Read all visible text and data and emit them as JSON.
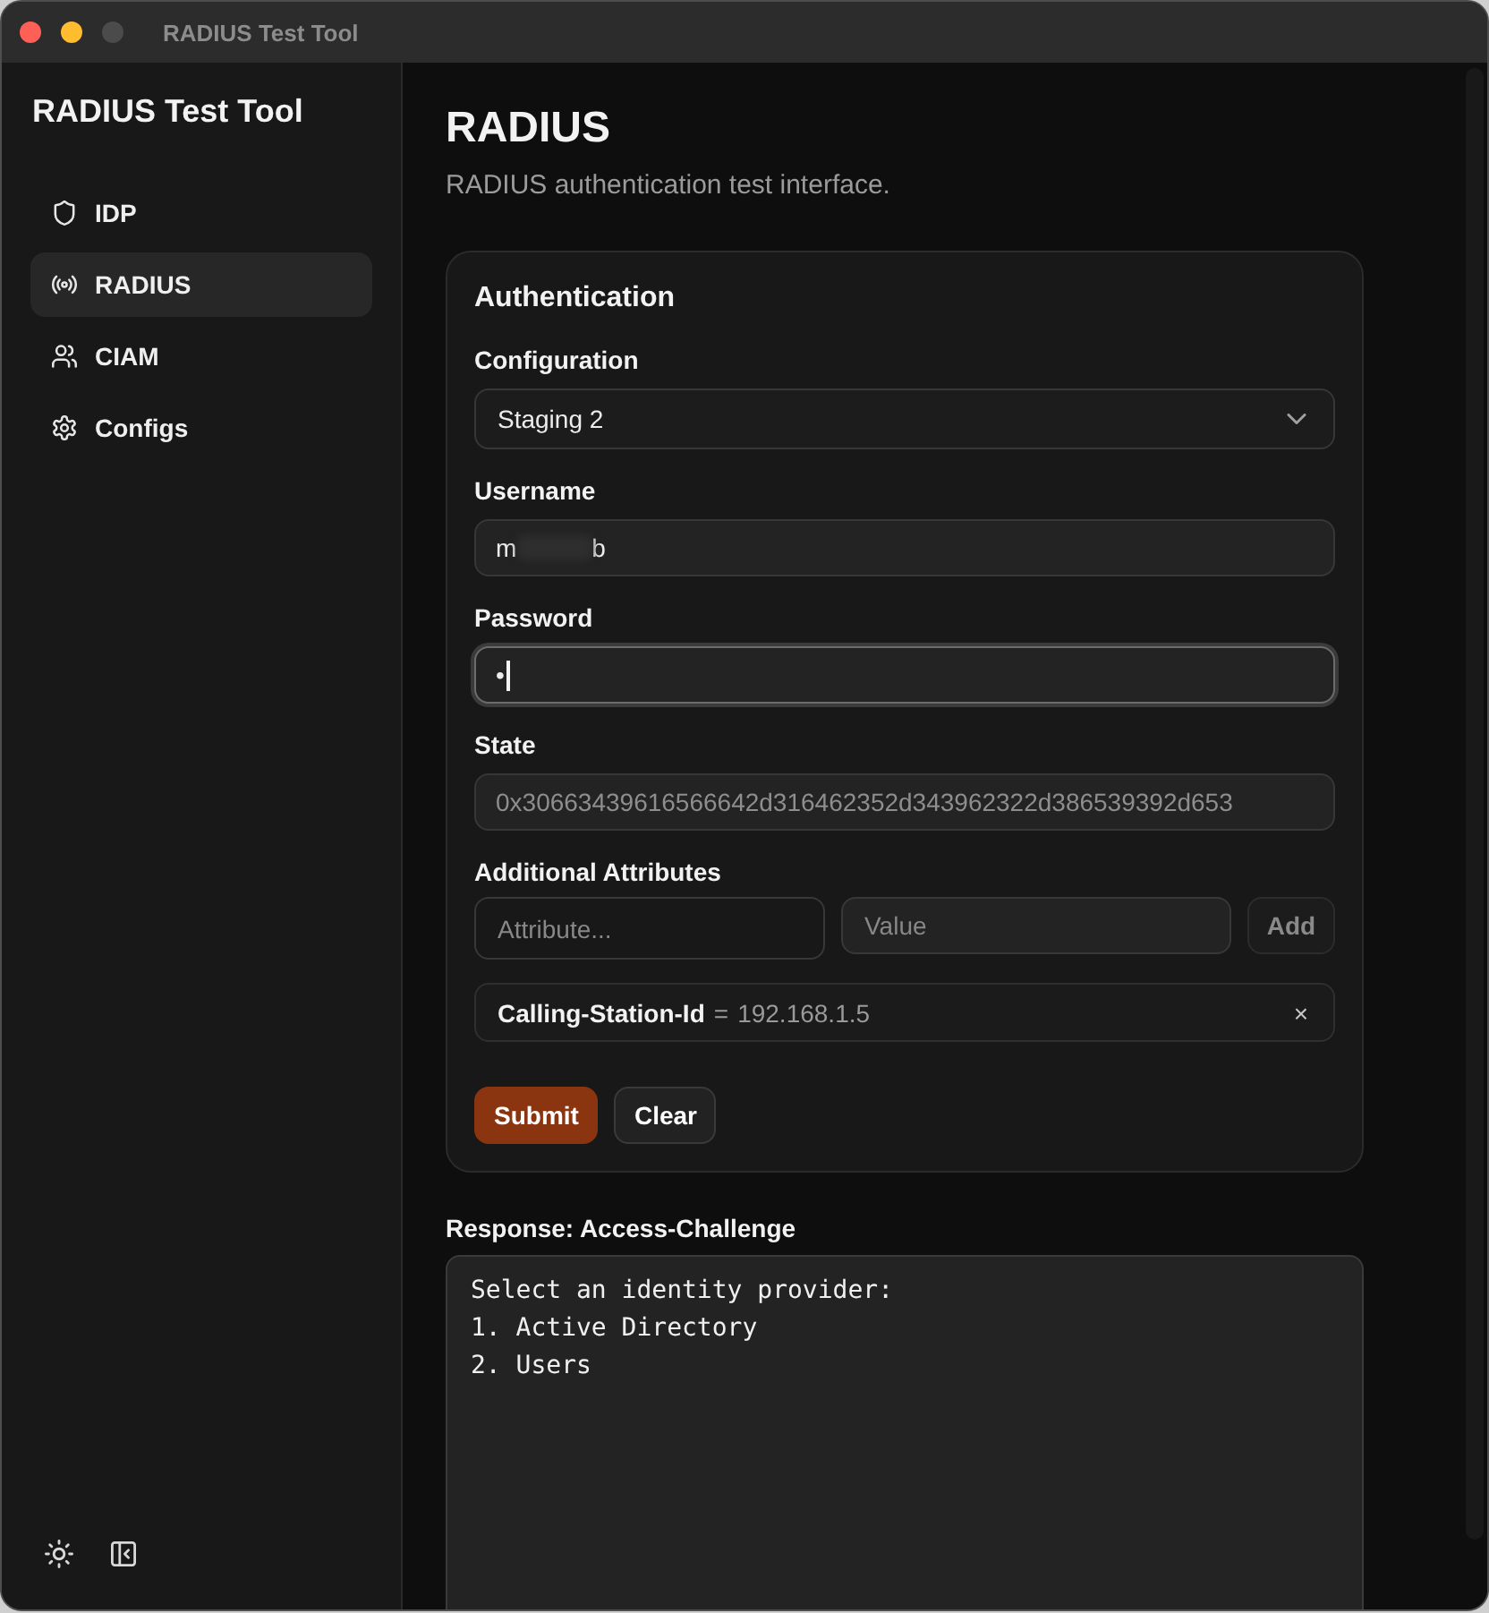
{
  "window": {
    "title": "RADIUS Test Tool"
  },
  "sidebar": {
    "title": "RADIUS Test Tool",
    "items": [
      {
        "label": "IDP",
        "selected": false
      },
      {
        "label": "RADIUS",
        "selected": true
      },
      {
        "label": "CIAM",
        "selected": false
      },
      {
        "label": "Configs",
        "selected": false
      }
    ]
  },
  "page": {
    "title": "RADIUS",
    "subtitle": "RADIUS authentication test interface."
  },
  "card": {
    "title": "Authentication",
    "fields": [
      {
        "kind": "select",
        "label": "Configuration",
        "value": "Staging 2",
        "focused": false,
        "disabled": false
      },
      {
        "kind": "text",
        "label": "Username",
        "value_parts": [
          "m",
          "b"
        ],
        "redacted": true,
        "focused": false,
        "disabled": false
      },
      {
        "kind": "password",
        "label": "Password",
        "value": "•",
        "focused": true,
        "disabled": false
      },
      {
        "kind": "text",
        "label": "State",
        "value": "0x30663439616566642d316462352d343962322d386539392d653",
        "focused": false,
        "disabled": true
      }
    ],
    "attribute_form": {
      "label": "Additional Attributes",
      "attribute_placeholder": "Attribute...",
      "value_placeholder": "Value",
      "add_button": {
        "label": "Add",
        "disabled": true
      }
    },
    "attributes": [
      {
        "name": "Calling-Station-Id",
        "separator": "=",
        "value": "192.168.1.5",
        "remove": "×"
      }
    ],
    "actions": [
      {
        "label": "Submit",
        "kind": "primary"
      },
      {
        "label": "Clear",
        "kind": "secondary"
      }
    ]
  },
  "response": {
    "label": "Response: Access-Challenge",
    "text": "Select an identity provider:\n1. Active Directory\n2. Users"
  }
}
